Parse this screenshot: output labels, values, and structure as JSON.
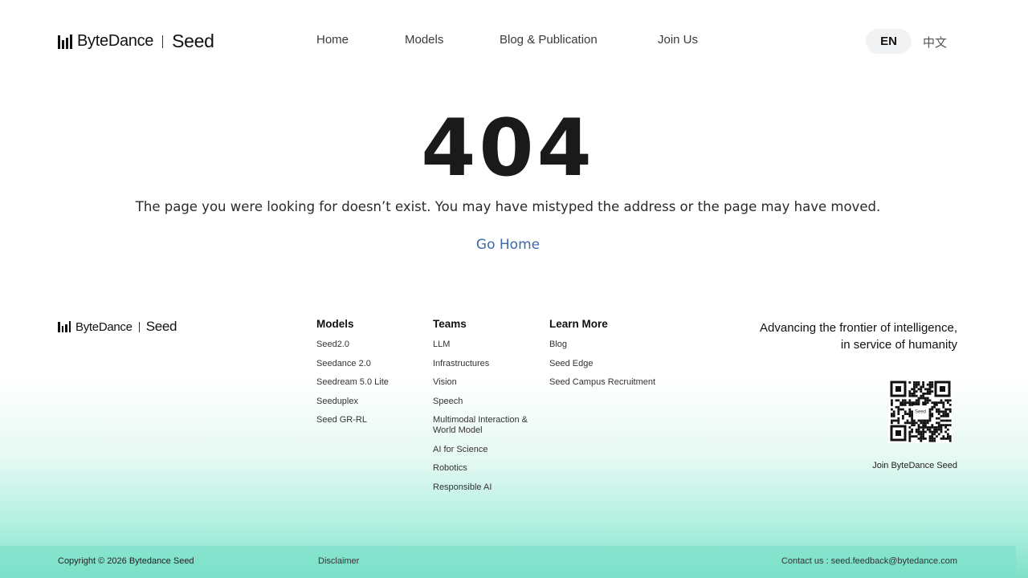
{
  "header": {
    "logo_brand": "ByteDance",
    "logo_product": "Seed",
    "nav": [
      {
        "label": "Home"
      },
      {
        "label": "Models"
      },
      {
        "label": "Blog & Publication"
      },
      {
        "label": "Join Us"
      }
    ],
    "lang_en": "EN",
    "lang_zh": "中文"
  },
  "main": {
    "code": "404",
    "message": "The page you were looking for doesn’t exist. You may have mistyped the address or the page may have moved.",
    "go_home": "Go Home"
  },
  "footer": {
    "logo_brand": "ByteDance",
    "logo_product": "Seed",
    "columns": [
      {
        "title": "Models",
        "items": [
          "Seed2.0",
          "Seedance 2.0",
          "Seedream 5.0 Lite",
          "Seeduplex",
          "Seed GR-RL"
        ]
      },
      {
        "title": "Teams",
        "items": [
          "LLM",
          "Infrastructures",
          "Vision",
          "Speech",
          "Multimodal Interaction & World Model",
          "AI for Science",
          "Robotics",
          "Responsible AI"
        ]
      },
      {
        "title": "Learn More",
        "items": [
          "Blog",
          "Seed Edge",
          "Seed Campus Recruitment"
        ]
      }
    ],
    "slogan_line1": "Advancing the frontier of intelligence,",
    "slogan_line2": "in service of humanity",
    "qr_label": "Seed",
    "join_label": "Join ByteDance Seed",
    "copyright": "Copyright © 2026 Bytedance Seed",
    "disclaimer": "Disclaimer",
    "contact": "Contact us : seed.feedback@bytedance.com"
  },
  "colors": {
    "link": "#3d69a8",
    "footer_gradient_end": "#7ee0c8",
    "lang_pill": "#f1f2f3"
  }
}
